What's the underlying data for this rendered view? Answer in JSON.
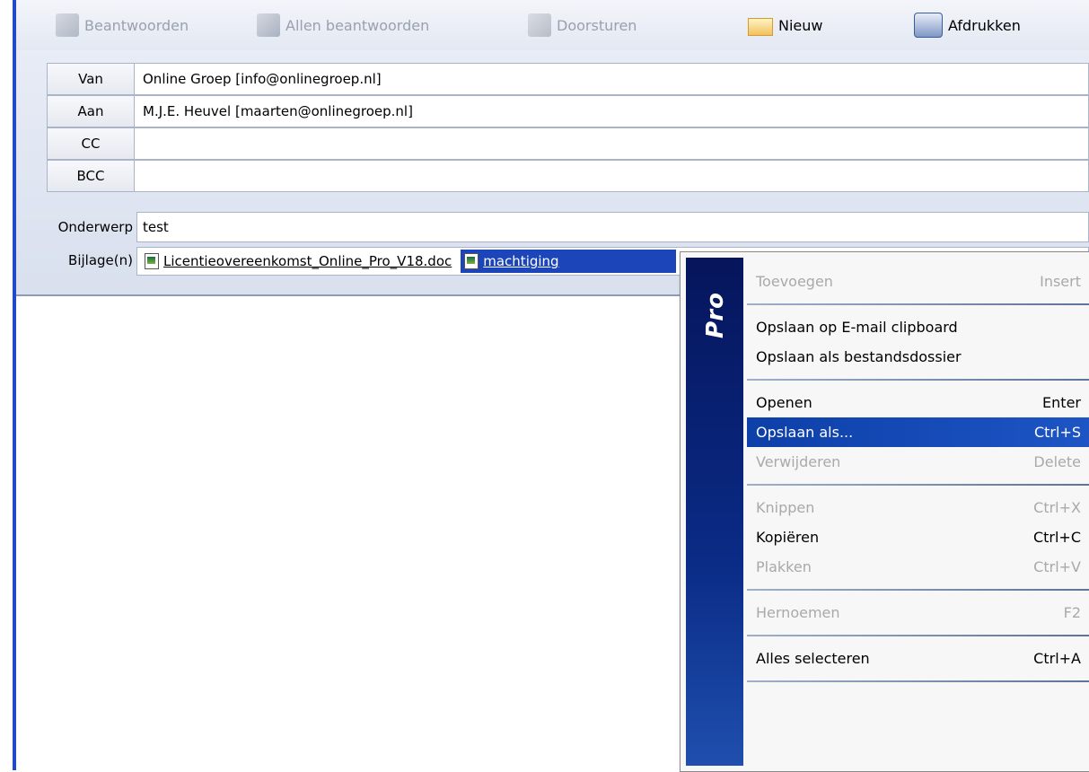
{
  "toolbar": {
    "reply": "Beantwoorden",
    "reply_all": "Allen beantwoorden",
    "forward": "Doorsturen",
    "new": "Nieuw",
    "print": "Afdrukken"
  },
  "address": {
    "from_label": "Van",
    "from_value": "Online Groep [info@onlinegroep.nl]",
    "to_label": "Aan",
    "to_value": "M.J.E. Heuvel [maarten@onlinegroep.nl]",
    "cc_label": "CC",
    "cc_value": "",
    "bcc_label": "BCC",
    "bcc_value": ""
  },
  "subject": {
    "label": "Onderwerp",
    "value": "test"
  },
  "attachments": {
    "label": "Bijlage(n)",
    "items": [
      "Licentieovereenkomst_Online_Pro_V18.doc",
      "machtiging"
    ]
  },
  "context_menu": {
    "brand": "Pro",
    "items": [
      {
        "label": "Toevoegen",
        "shortcut": "Insert"
      },
      {
        "label": "Opslaan op E-mail clipboard",
        "shortcut": ""
      },
      {
        "label": "Opslaan als bestandsdossier",
        "shortcut": ""
      },
      {
        "label": "Openen",
        "shortcut": "Enter"
      },
      {
        "label": "Opslaan als...",
        "shortcut": "Ctrl+S"
      },
      {
        "label": "Verwijderen",
        "shortcut": "Delete"
      },
      {
        "label": "Knippen",
        "shortcut": "Ctrl+X"
      },
      {
        "label": "Kopiëren",
        "shortcut": "Ctrl+C"
      },
      {
        "label": "Plakken",
        "shortcut": "Ctrl+V"
      },
      {
        "label": "Hernoemen",
        "shortcut": "F2"
      },
      {
        "label": "Alles selecteren",
        "shortcut": "Ctrl+A"
      }
    ]
  },
  "colors": {
    "accent": "#1c45b9",
    "menu_highlight": "#0d3fa8",
    "stripe": "#06155c"
  }
}
